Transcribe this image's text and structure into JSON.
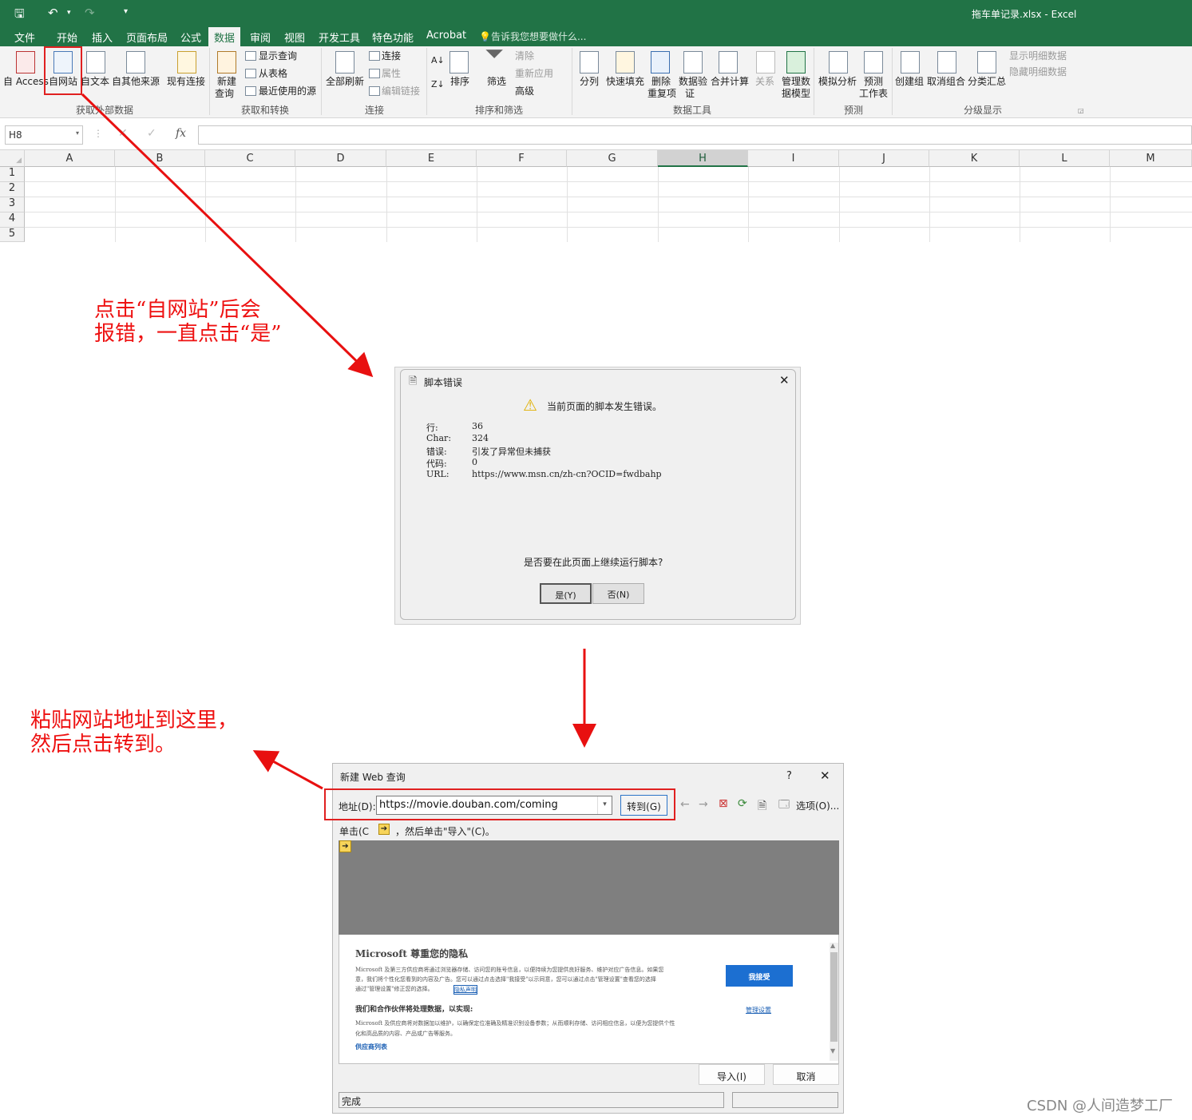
{
  "excel": {
    "doc_title": "拖车单记录.xlsx - Excel",
    "tabs": [
      "文件",
      "开始",
      "插入",
      "页面布局",
      "公式",
      "数据",
      "审阅",
      "视图",
      "开发工具",
      "特色功能",
      "Acrobat"
    ],
    "active_tab": "数据",
    "tell_me": "告诉我您想要做什么...",
    "ribbon": {
      "get_external": {
        "access": "自 Access",
        "web": "自网站",
        "text": "自文本",
        "other": "自其他来源",
        "existing": "现有连接",
        "group": "获取外部数据"
      },
      "get_transform": {
        "new_query_1": "新建",
        "new_query_2": "查询",
        "show_queries": "显示查询",
        "from_table": "从表格",
        "recent_sources": "最近使用的源",
        "group": "获取和转换"
      },
      "connections": {
        "refresh_all": "全部刷新",
        "connections": "连接",
        "properties": "属性",
        "edit_links": "编辑链接",
        "group": "连接"
      },
      "sort_filter": {
        "sort": "排序",
        "filter": "筛选",
        "clear": "清除",
        "reapply": "重新应用",
        "advanced": "高级",
        "group": "排序和筛选"
      },
      "data_tools": {
        "text_to_columns": "分列",
        "flash_fill": "快速填充",
        "remove_dup_1": "删除",
        "remove_dup_2": "重复项",
        "validation_1": "数据验",
        "validation_2": "证",
        "consolidate": "合并计算",
        "relationships": "关系",
        "manage_model_1": "管理数",
        "manage_model_2": "据模型",
        "group": "数据工具"
      },
      "forecast": {
        "whatif": "模拟分析",
        "sheet_1": "预测",
        "sheet_2": "工作表",
        "group": "预测"
      },
      "outline": {
        "group_btn": "创建组",
        "ungroup": "取消组合",
        "subtotal": "分类汇总",
        "show_detail": "显示明细数据",
        "hide_detail": "隐藏明细数据",
        "group": "分级显示"
      }
    },
    "name_box": "H8",
    "fx": "fx",
    "columns": [
      "A",
      "B",
      "C",
      "D",
      "E",
      "F",
      "G",
      "H",
      "I",
      "J",
      "K",
      "L",
      "M"
    ],
    "selected_column": "H",
    "rows": [
      "1",
      "2",
      "3",
      "4",
      "5"
    ]
  },
  "annotations": {
    "note1_line1": "点击“自网站”后会",
    "note1_line2": "报错，一直点击“是”",
    "note2_line1": "粘贴网站地址到这里，",
    "note2_line2": "然后点击转到。"
  },
  "script_error": {
    "title": "脚本错误",
    "heading": "当前页面的脚本发生错误。",
    "labels": [
      "行:",
      "Char:",
      "错误:",
      "代码:",
      "URL:"
    ],
    "values": [
      "36",
      "324",
      "引发了异常但未捕获",
      "0",
      "https://www.msn.cn/zh-cn?OCID=fwdbahp"
    ],
    "question": "是否要在此页面上继续运行脚本?",
    "yes": "是(Y)",
    "no": "否(N)"
  },
  "web_query": {
    "title": "新建 Web 查询",
    "help": "?",
    "address_label": "地址(D):",
    "address_value": "https://movie.douban.com/coming",
    "go_button": "转到(G)",
    "options": "选项(O)...",
    "instruction_a": "单击(C",
    "instruction_b": "，然后单击\"导入\"(C)。",
    "privacy_title": "Microsoft 尊重您的隐私",
    "privacy_line1": "Microsoft 及第三方供应商将通过浏览器存储、访问您的账号信息，以便持续为您提供良好服务、维护对应广告信息。如果您",
    "privacy_line2": "意，我们将个性化您看到的内容及广告。您可以通过点击选择\"我接受\"以示同意，您可以通过点击\"管理设置\"查看您的选择",
    "privacy_line3": "通过\"管理设置\"修正您的选择。",
    "privacy_link": "隐私声明",
    "accept": "我接受",
    "partner_title": "我们和合作伙伴将处理数据，以实现:",
    "manage_settings": "管理设置",
    "partner_line1": "Microsoft 及供应商将对数据加以维护，以确保定位准确及精准识别设备参数；从而顺利存储、访问相应信息，以便为您提供个性",
    "partner_line2": "化和高品质的内容、产品或广告等服务。",
    "vendor_list": "供应商列表",
    "import": "导入(I)",
    "cancel": "取消",
    "status": "完成"
  },
  "watermark": "CSDN @人间造梦工厂"
}
